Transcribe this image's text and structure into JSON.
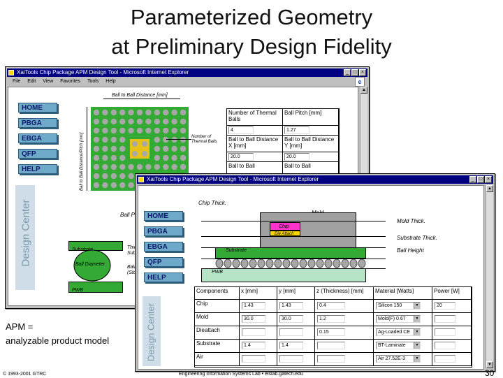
{
  "slide": {
    "title_line1": "Parameterized Geometry",
    "title_line2": "at Preliminary Design Fidelity",
    "caption_line1": "APM =",
    "caption_line2": "analyzable product model",
    "copyright": "© 1993-2001 GTRC",
    "footer_center": "Engineering Information Systems Lab  •  eislab.gatech.edu",
    "page_number": "30"
  },
  "window1": {
    "title": "XaiTools Chip Package APM Design Tool - Microsoft Internet Explorer",
    "menu": [
      "File",
      "Edit",
      "View",
      "Favorites",
      "Tools",
      "Help"
    ],
    "nav": [
      "HOME",
      "PBGA",
      "EBGA",
      "QFP",
      "HELP"
    ],
    "label_ball_distance": "Ball to Ball Distance [mm]",
    "label_vertical": "Ball to Ball Distance/Pitch [mm]",
    "label_thermal": "Number of\nThermal Balls",
    "label_bottom": "Ball P",
    "label_substrate": "Substrate",
    "label_ball_diameter": "Ball Diameter",
    "label_pwb": "PWB",
    "label_trunc1": "Thick\nSubst",
    "label_trunc2": "Ball\n(Std",
    "table": [
      [
        "Number of Thermal Balls",
        "Ball Pitch [mm]"
      ],
      [
        "4",
        "1.27"
      ],
      [
        "Ball to Ball Distance X [mm]",
        "Ball to Ball Distance Y [mm]"
      ],
      [
        "20.0",
        "20.0"
      ],
      [
        "Ball to Ball",
        "Ball to Ball"
      ]
    ],
    "colors": {
      "board": "#33aa33",
      "chip": "#e6c21a",
      "ball": "#a8a8a8"
    }
  },
  "window2": {
    "title": "XaiTools Chip Package APM Design Tool - Microsoft Internet Explorer",
    "nav": [
      "HOME",
      "PBGA",
      "EBGA",
      "QFP",
      "HELP"
    ],
    "labels": {
      "chip_thick": "Chip Thick.",
      "mold": "Mold",
      "mold_thick": "Mold Thick.",
      "chip": "Chip",
      "die_attach": "Die Attach",
      "substrate": "Substrate",
      "substrate_thick": "Substrate Thick.",
      "ball_height": "Ball Height",
      "pwb": "PWB"
    },
    "table_header": [
      "Components",
      "x [mm]",
      "y [mm]",
      "z (Thickness) [mm]",
      "Material [Watts]",
      "Power [W]"
    ],
    "rows": [
      {
        "name": "Chip",
        "x": "1.43",
        "y": "1.43",
        "z": "0.4",
        "material": "Silicon 150",
        "power": "20"
      },
      {
        "name": "Mold",
        "x": "30.0",
        "y": "30.0",
        "z": "1.2",
        "material": "Mold(F) 0.67",
        "power": ""
      },
      {
        "name": "Dieattach",
        "x": "",
        "y": "",
        "z": "0.15",
        "material": "Ag-Loaded CE",
        "power": ""
      },
      {
        "name": "Substrate",
        "x": "1.4",
        "y": "1.4",
        "z": "",
        "material": "BT-Laminate",
        "power": ""
      },
      {
        "name": "Air",
        "x": "",
        "y": "",
        "z": "",
        "material": "Air 27.52E-3",
        "power": ""
      }
    ],
    "colors": {
      "mold": "#a0a0a0",
      "chip": "#ff33cc",
      "substrate": "#33aa33",
      "ball": "#a8a8a8"
    }
  },
  "watermark": {
    "word1": "Design",
    "word2": "Center"
  }
}
